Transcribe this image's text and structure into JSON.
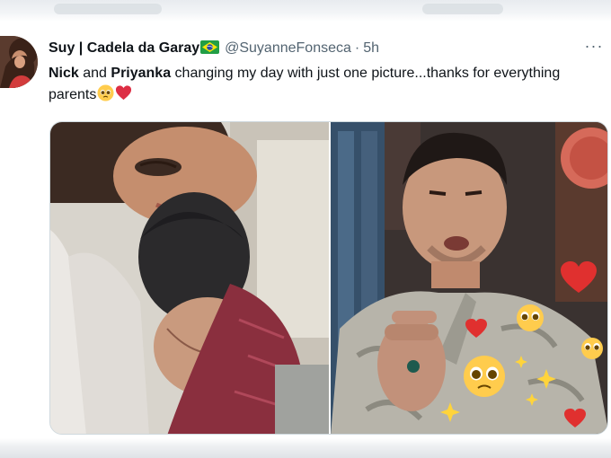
{
  "tweet": {
    "display_name": "Suy | Cadela da Garay",
    "flag_icon": "brazil-flag-icon",
    "handle": "@SuyanneFonseca",
    "separator": "·",
    "time": "5h",
    "more_icon": "more-options-icon",
    "text": {
      "name1": "Nick",
      "conj": " and ",
      "name2": "Priyanka",
      "rest": " changing my day with just one picture...thanks for everything parents"
    },
    "emojis": [
      "pleading-face-emoji",
      "red-heart-emoji"
    ],
    "media": [
      {
        "name": "photo-couple-hug"
      },
      {
        "name": "photo-man-with-emojis"
      }
    ]
  },
  "colors": {
    "text": "#0f1419",
    "secondary": "#536471",
    "border": "#cfd9de"
  }
}
